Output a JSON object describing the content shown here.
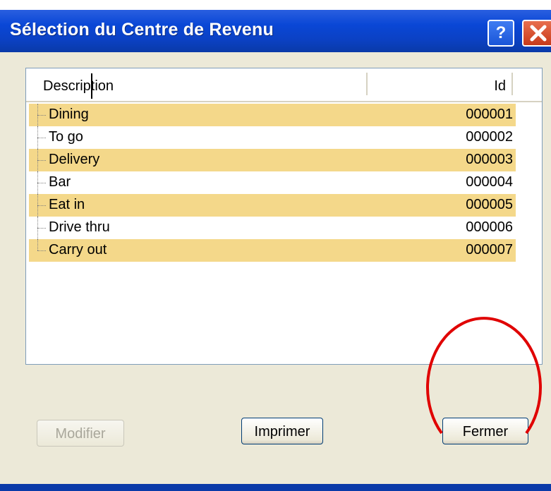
{
  "window": {
    "title": "Sélection du Centre de Revenu",
    "help_glyph": "?",
    "close_icon": "close-icon"
  },
  "table": {
    "headers": {
      "description": "Description",
      "id": "Id"
    },
    "rows": [
      {
        "description": "Dining",
        "id": "000001",
        "highlighted": true
      },
      {
        "description": "To go",
        "id": "000002",
        "highlighted": false
      },
      {
        "description": "Delivery",
        "id": "000003",
        "highlighted": true
      },
      {
        "description": "Bar",
        "id": "000004",
        "highlighted": false
      },
      {
        "description": "Eat in",
        "id": "000005",
        "highlighted": true
      },
      {
        "description": "Drive thru",
        "id": "000006",
        "highlighted": false
      },
      {
        "description": "Carry out",
        "id": "000007",
        "highlighted": true
      }
    ]
  },
  "buttons": {
    "modify": "Modifier",
    "print": "Imprimer",
    "close": "Fermer"
  },
  "colors": {
    "row_highlight": "#f4d88a",
    "titlebar": "#0b41c4",
    "annotation": "#e00000"
  }
}
